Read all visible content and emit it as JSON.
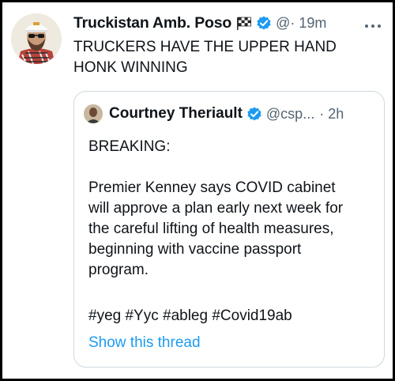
{
  "tweet": {
    "author_name": "Truckistan Amb. Poso",
    "handle_fragment": "@",
    "time": "· 19m",
    "text_lines": [
      "TRUCKERS HAVE THE UPPER HAND",
      "HONK WINNING"
    ],
    "icons": [
      "checkered-flag-icon",
      "verified-icon",
      "more-icon"
    ]
  },
  "quoted": {
    "author_name": "Courtney Theriault",
    "handle": "@csp...",
    "time": "· 2h",
    "breaking": "BREAKING:",
    "body_lines": [
      "Premier Kenney says COVID cabinet",
      "will approve a plan early next week for",
      "the careful lifting of health measures,",
      "beginning with vaccine passport",
      "program."
    ],
    "hashtags": "#yeg #Yyc #ableg #Covid19ab",
    "show_thread": "Show this thread",
    "colors": {
      "link": "#1d9bf0",
      "verified": "#1d9bf0"
    }
  }
}
